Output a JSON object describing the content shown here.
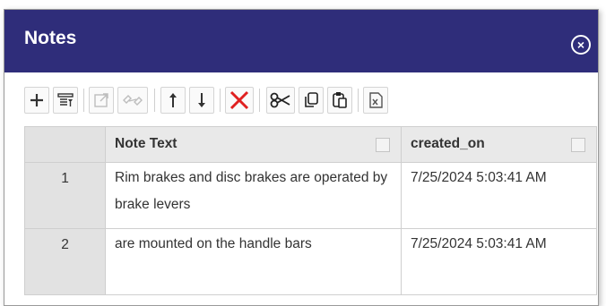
{
  "dialog": {
    "title": "Notes",
    "close_icon": "close-circle-icon"
  },
  "toolbar": {
    "buttons": [
      {
        "name": "add",
        "icon": "plus-icon",
        "enabled": true
      },
      {
        "name": "filter",
        "icon": "filter-list-icon",
        "enabled": true
      },
      {
        "name": "open",
        "icon": "open-external-icon",
        "enabled": false
      },
      {
        "name": "link",
        "icon": "link-icon",
        "enabled": false
      },
      {
        "name": "move-up",
        "icon": "arrow-up-icon",
        "enabled": true
      },
      {
        "name": "move-down",
        "icon": "arrow-down-icon",
        "enabled": true
      },
      {
        "name": "delete",
        "icon": "delete-x-icon",
        "enabled": true,
        "color": "#e02020"
      },
      {
        "name": "cut",
        "icon": "scissors-icon",
        "enabled": true
      },
      {
        "name": "copy",
        "icon": "copy-icon",
        "enabled": true
      },
      {
        "name": "paste",
        "icon": "paste-icon",
        "enabled": true
      },
      {
        "name": "export-excel",
        "icon": "excel-icon",
        "enabled": true
      }
    ]
  },
  "grid": {
    "columns": [
      "Note Text",
      "created_on"
    ],
    "rows": [
      {
        "num": "1",
        "note_text": "Rim brakes and disc brakes are operated by brake levers",
        "created_on": "7/25/2024 5:03:41 AM"
      },
      {
        "num": "2",
        "note_text": "are mounted on the handle bars",
        "created_on": "7/25/2024 5:03:41 AM"
      }
    ]
  },
  "colors": {
    "titlebar": "#2f2d7a",
    "accent_delete": "#e02020"
  }
}
